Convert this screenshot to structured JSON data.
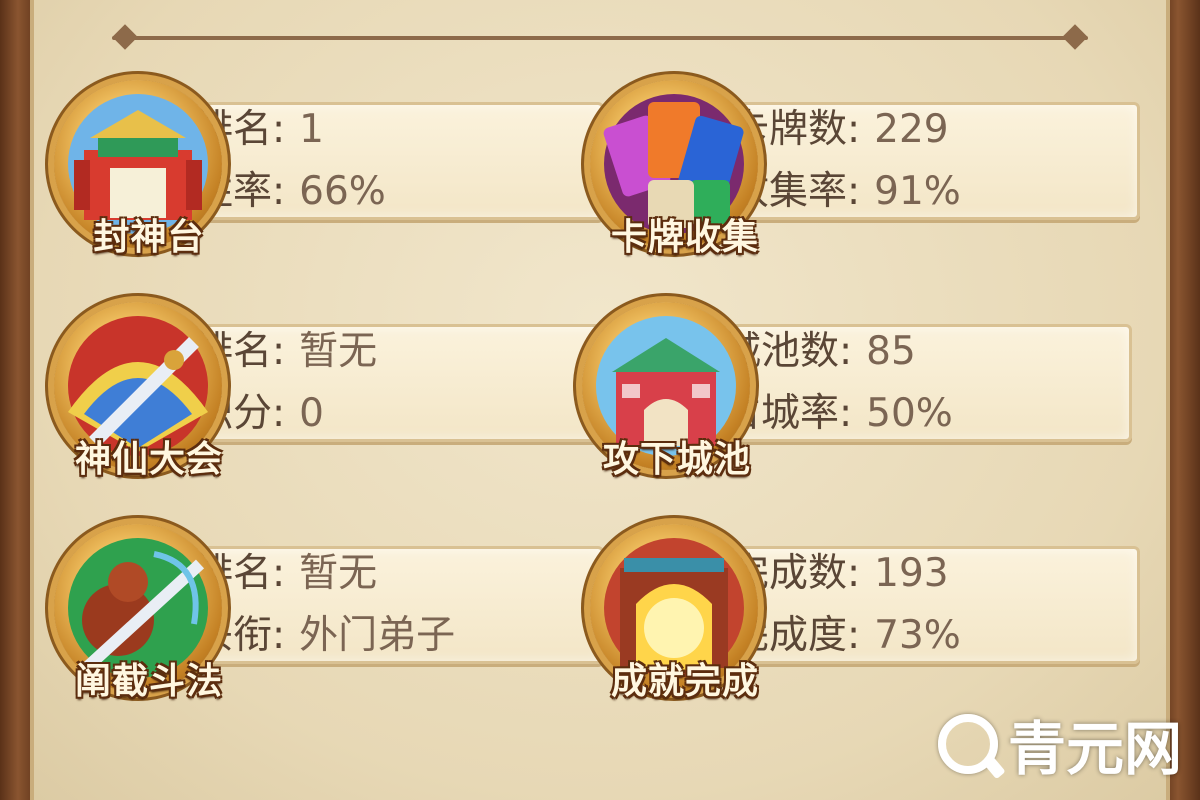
{
  "cards": [
    {
      "title": "封神台",
      "row1_label": "排名:",
      "row1_value": "1",
      "row2_label": "胜率:",
      "row2_value": "66%",
      "icon": "temple-icon"
    },
    {
      "title": "卡牌收集",
      "row1_label": "卡牌数:",
      "row1_value": "229",
      "row2_label": "收集率:",
      "row2_value": "91%",
      "icon": "cards-icon"
    },
    {
      "title": "神仙大会",
      "row1_label": "排名:",
      "row1_value": "暂无",
      "row2_label": "积分:",
      "row2_value": "0",
      "icon": "sword-fan-icon"
    },
    {
      "title": "攻下城池",
      "row1_label": "城池数:",
      "row1_value": "85",
      "row2_label": "占城率:",
      "row2_value": "50%",
      "icon": "castle-icon"
    },
    {
      "title": "阐截斗法",
      "row1_label": "排名:",
      "row1_value": "暂无",
      "row2_label": "头衔:",
      "row2_value": "外门弟子",
      "icon": "gourd-sword-icon"
    },
    {
      "title": "成就完成",
      "row1_label": "完成数:",
      "row1_value": "193",
      "row2_label": "完成度:",
      "row2_value": "73%",
      "icon": "golden-gate-icon"
    }
  ],
  "watermark": {
    "text": "青元网",
    "icon": "search-q-icon"
  },
  "colors": {
    "panel_bg": "#ece0c2",
    "frame": "#7a4a28",
    "text": "#5a4636",
    "title_text": "#fff7e0",
    "title_outline": "#5c2d0e"
  }
}
